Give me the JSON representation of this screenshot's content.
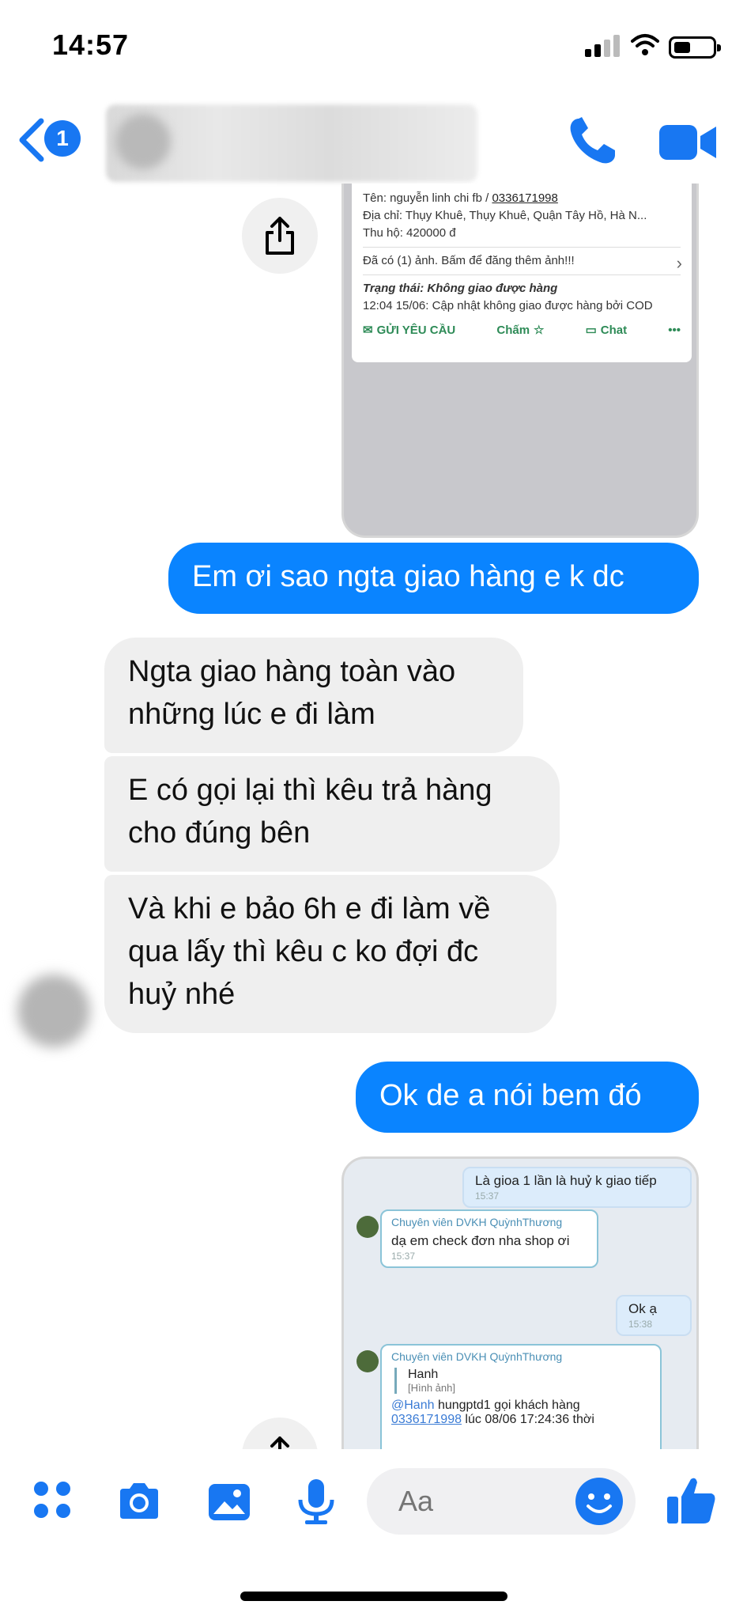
{
  "status_bar": {
    "time": "14:57"
  },
  "header": {
    "back_badge_count": "1"
  },
  "shared_card": {
    "name_line_prefix": "Tên: nguyễn linh chi fb / ",
    "phone": "0336171998",
    "address": "Địa chỉ: Thụy Khuê, Thụy Khuê, Quận Tây Hồ, Hà N...",
    "cod": "Thu hộ: 420000 đ",
    "photo_note": "Đã có (1) ảnh. Bấm để đăng thêm ảnh!!!",
    "status_label": "Trạng thái:",
    "status_value": "Không giao được hàng",
    "update": "12:04 15/06: Cập nhật không giao được hàng bởi COD",
    "actions": [
      "GỬI YÊU CẦU",
      "Chấm",
      "Chat",
      "•••"
    ]
  },
  "messages": [
    {
      "dir": "out",
      "text": "Em ơi sao ngta giao hàng e k dc"
    },
    {
      "dir": "in",
      "text": "Ngta giao hàng toàn vào những lúc e đi làm"
    },
    {
      "dir": "in",
      "text": "E có gọi lại thì kêu trả hàng cho đúng bên"
    },
    {
      "dir": "in",
      "text": "Và khi e bảo 6h e đi làm về qua lấy thì kêu c ko đợi đc huỷ nhé"
    },
    {
      "dir": "out",
      "text": "Ok de a nói bem đó"
    }
  ],
  "shared_chat": {
    "msg1": {
      "text": "Là gioa 1 lần là huỷ k giao tiếp",
      "time": "15:37"
    },
    "msg2": {
      "agent": "Chuyên viên DVKH QuỳnhThương",
      "text": "dạ em check đơn nha shop ơi",
      "time": "15:37"
    },
    "msg3": {
      "text": "Ok ạ",
      "time": "15:38"
    },
    "msg4": {
      "agent": "Chuyên viên DVKH QuỳnhThương",
      "quote_name": "Hanh",
      "quote_sub": "[Hình ảnh]",
      "mention": "@Hanh",
      "text": " hungptd1 gọi khách hàng",
      "phone": "0336171998",
      "tail": " lúc 08/06 17:24:36 thời"
    }
  },
  "composer": {
    "placeholder": "Aa"
  },
  "colors": {
    "accent": "#0a84ff",
    "incoming_bubble": "#efefef"
  }
}
